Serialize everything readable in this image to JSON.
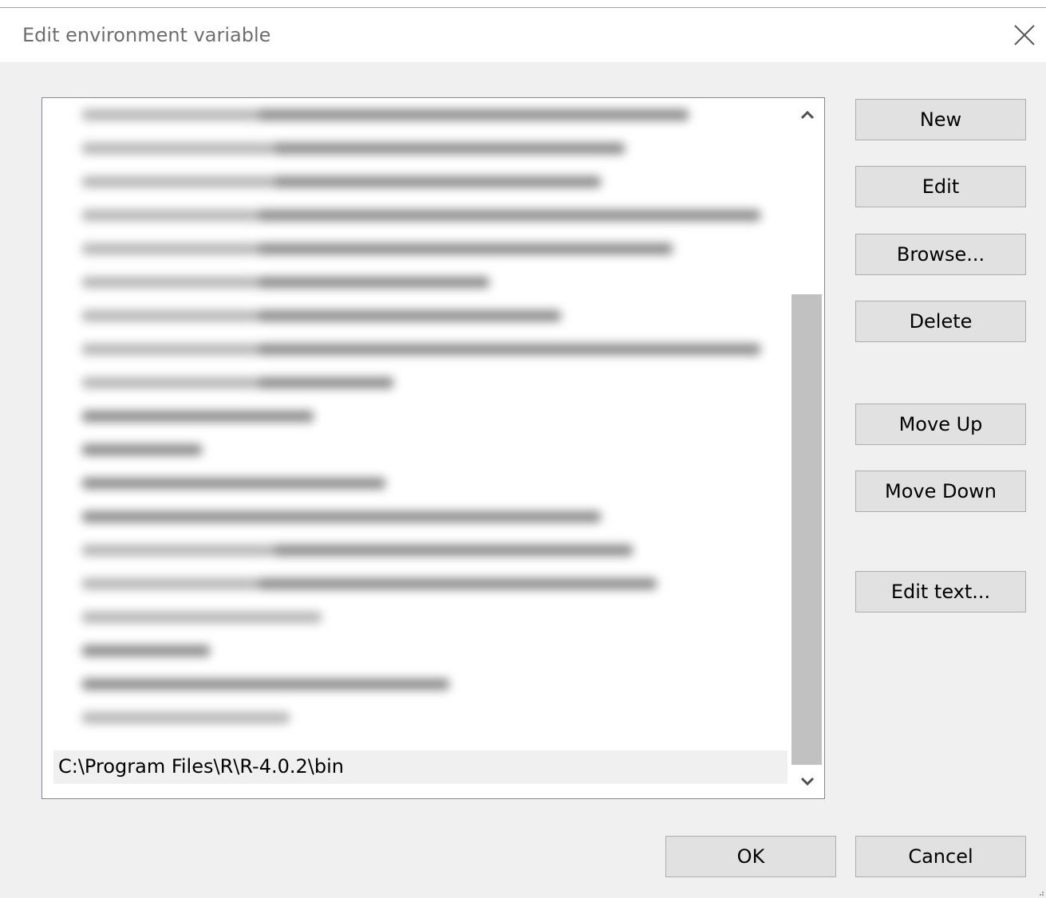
{
  "window": {
    "title": "Edit environment variable"
  },
  "list": {
    "selected_item": "C:\\Program Files\\R\\R-4.0.2\\bin"
  },
  "buttons": {
    "new": "New",
    "edit": "Edit",
    "browse": "Browse...",
    "delete": "Delete",
    "move_up": "Move Up",
    "move_down": "Move Down",
    "edit_text": "Edit text...",
    "ok": "OK",
    "cancel": "Cancel"
  },
  "icons": {
    "close": "close-icon",
    "scroll_up": "chevron-up-icon",
    "scroll_down": "chevron-down-icon"
  },
  "colors": {
    "background": "#f0f0f0",
    "button_face": "#e1e1e1",
    "button_border": "#adadad",
    "scroll_thumb": "#c1c1c1"
  }
}
